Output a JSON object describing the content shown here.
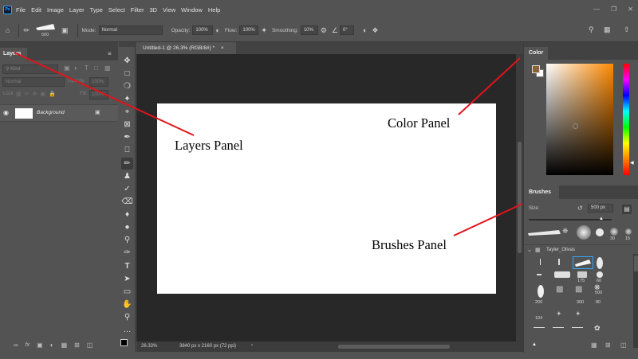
{
  "app": {
    "logo": "Ps"
  },
  "menu": [
    "File",
    "Edit",
    "Image",
    "Layer",
    "Type",
    "Select",
    "Filter",
    "3D",
    "View",
    "Window",
    "Help"
  ],
  "options_bar": {
    "brush_size": "500",
    "mode_label": "Mode:",
    "mode_value": "Normal",
    "opacity_label": "Opacity:",
    "opacity_value": "100%",
    "flow_label": "Flow:",
    "flow_value": "100%",
    "smoothing_label": "Smoothing:",
    "smoothing_value": "10%",
    "angle_value": "0°"
  },
  "layers_panel": {
    "tab": "Layers",
    "search_placeholder": "Kind",
    "blend_mode": "Normal",
    "opacity_label": "Opacity:",
    "opacity_value": "100%",
    "lock_label": "Lock:",
    "fill_label": "Fill:",
    "fill_value": "100%",
    "layer_name": "Background",
    "footer_fx": "fx"
  },
  "document": {
    "tab_title": "Untitled-1 @ 26.3% (RGB/8#) *",
    "zoom": "26.33%",
    "dimensions": "3840 px x 2160 px (72 ppi)"
  },
  "color_panel": {
    "tab": "Color",
    "foreground": "#8c6239",
    "background": "#ffffff",
    "hue_color": "#ff8a00"
  },
  "brushes_panel": {
    "tab": "Brushes",
    "size_label": "Size:",
    "size_value": "500 px",
    "preset_labels": [
      "30",
      "15"
    ],
    "group_name": "Tayler_Olivas",
    "grid_labels": [
      "175",
      "60",
      "200",
      "300",
      "80",
      "500",
      "104"
    ]
  },
  "annotations": {
    "layers": "Layers Panel",
    "color": "Color Panel",
    "brushes": "Brushes Panel"
  },
  "colors": {
    "annotation_line": "#e0141b",
    "accent_blue": "#31a8ff"
  }
}
